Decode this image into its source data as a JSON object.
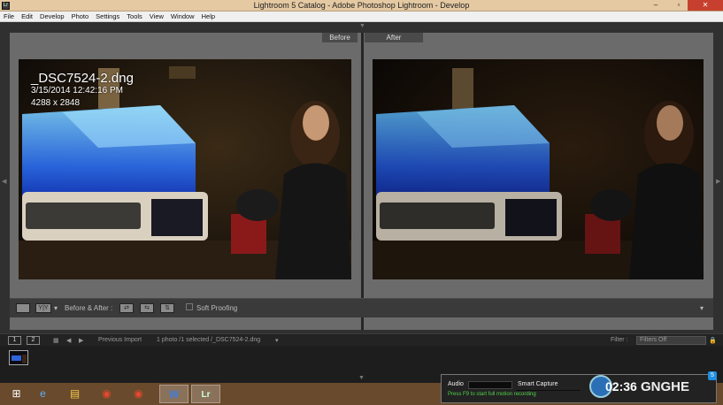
{
  "window": {
    "app_icon": "Lr",
    "title": "Lightroom 5 Catalog - Adobe Photoshop Lightroom - Develop",
    "minimize": "–",
    "maximize": "▫",
    "close": "✕"
  },
  "menu": [
    "File",
    "Edit",
    "Develop",
    "Photo",
    "Settings",
    "Tools",
    "View",
    "Window",
    "Help"
  ],
  "viewer": {
    "before_label": "Before",
    "after_label": "After",
    "photo_name": "_DSC7524-2.dng",
    "photo_datetime": "3/15/2014 12:42:16 PM",
    "photo_dimensions": "4288 x 2848"
  },
  "toolbar": {
    "yy_label": "Y|Y",
    "before_after_label": "Before & After :",
    "soft_proofing_label": "Soft Proofing",
    "soft_proofing_checked": false
  },
  "filmstrip_bar": {
    "screen1": "1",
    "screen2": "2",
    "source_label": "Previous Import",
    "selection_info": "1 photo /1 selected /_DSC7524-2.dng",
    "filter_label": "Filter :",
    "filter_value": "Filters Off"
  },
  "taskbar": {
    "items": [
      "windows-start",
      "internet-explorer",
      "file-explorer",
      "chrome",
      "chrome-alt",
      "word",
      "lightroom"
    ],
    "active": "lightroom"
  },
  "recorder": {
    "audio_label": "Audio",
    "capture_label": "Smart Capture",
    "hint": "Press F9 to start full motion recording",
    "time": "02:36",
    "brand_text": "GNGHE",
    "brand_badge": "5"
  },
  "colors": {
    "titlebar": "#e4c9a2",
    "close_button": "#c7402f",
    "taskbar": "#6a4a2c",
    "recorder_hint": "#52d24a"
  }
}
